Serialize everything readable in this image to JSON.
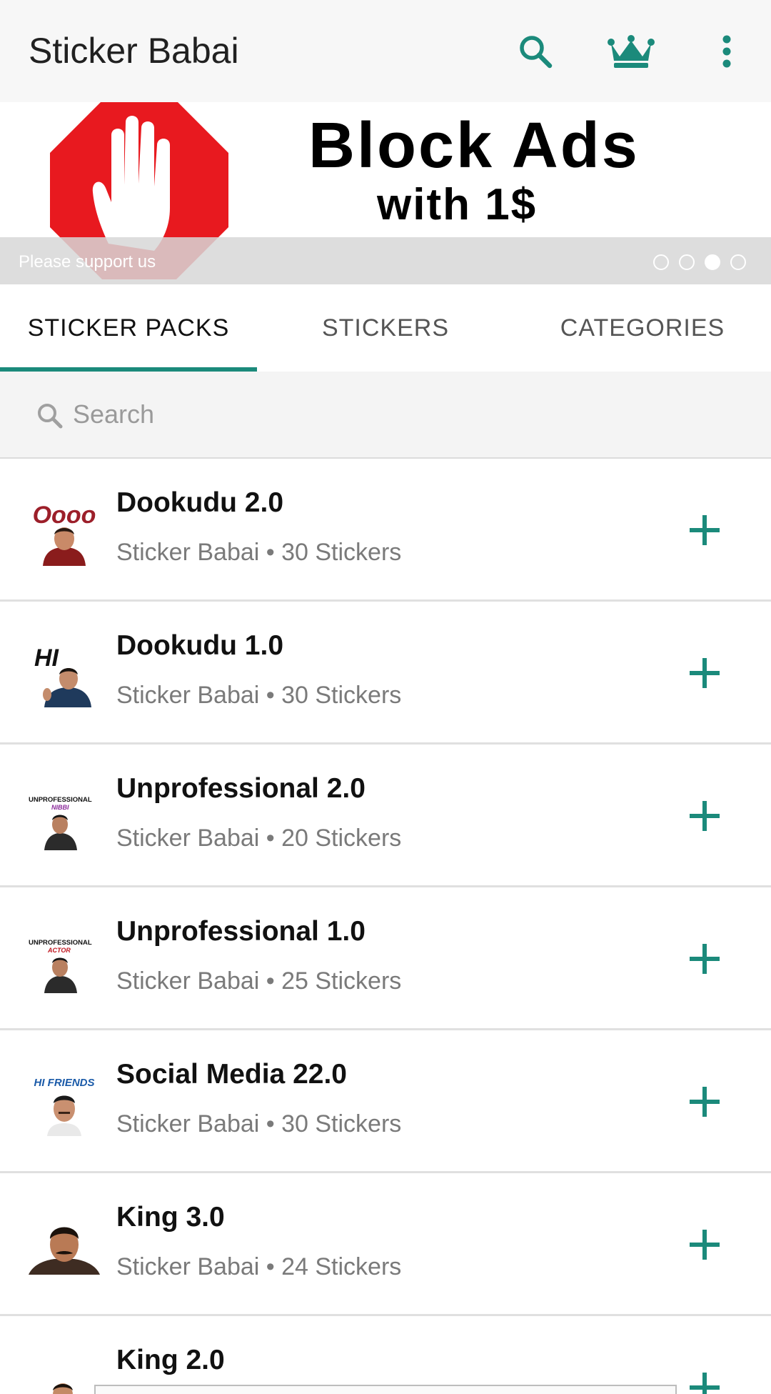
{
  "appbar": {
    "title": "Sticker Babai",
    "icons": [
      "search-icon",
      "crown-icon",
      "more-vert-icon"
    ]
  },
  "banner": {
    "headline": "Block Ads",
    "subline": "with 1$",
    "caption": "Please support us",
    "slide_count": 4,
    "active_slide": 3
  },
  "tabs": [
    {
      "label": "STICKER PACKS",
      "active": true
    },
    {
      "label": "STICKERS",
      "active": false
    },
    {
      "label": "CATEGORIES",
      "active": false
    }
  ],
  "search": {
    "placeholder": "Search",
    "value": ""
  },
  "packs": [
    {
      "name": "Dookudu 2.0",
      "meta": "Sticker Babai • 30 Stickers",
      "thumb_text": "Oooo"
    },
    {
      "name": "Dookudu 1.0",
      "meta": "Sticker Babai • 30 Stickers",
      "thumb_text": "HI"
    },
    {
      "name": "Unprofessional 2.0",
      "meta": "Sticker Babai • 20 Stickers",
      "thumb_text": "UNPROFESSIONAL NIBBI"
    },
    {
      "name": "Unprofessional 1.0",
      "meta": "Sticker Babai • 25 Stickers",
      "thumb_text": "UNPROFESSIONAL ACTOR"
    },
    {
      "name": "Social Media 22.0",
      "meta": "Sticker Babai • 30 Stickers",
      "thumb_text": "HI FRIENDS"
    },
    {
      "name": "King 3.0",
      "meta": "Sticker Babai • 24 Stickers",
      "thumb_text": ""
    },
    {
      "name": "King 2.0",
      "meta": "",
      "thumb_text": ""
    }
  ],
  "colors": {
    "accent": "#1b8a7b",
    "stop_red": "#e8191f",
    "title_text": "#212121",
    "meta_text": "#7a7a7a"
  }
}
